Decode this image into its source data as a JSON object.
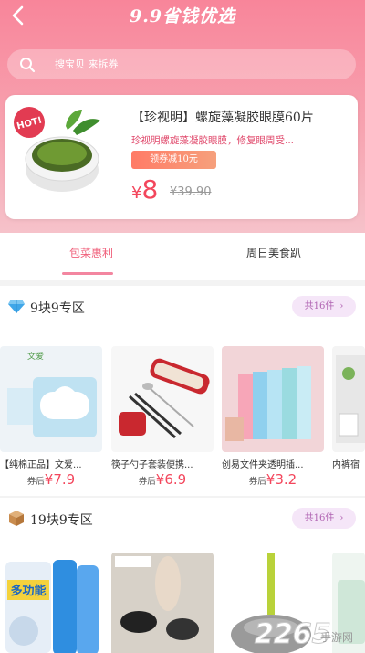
{
  "header": {
    "back_icon": "chevron-left-icon",
    "title": "9.9省钱优选"
  },
  "search": {
    "placeholder": "搜宝贝 来拆券"
  },
  "featured": {
    "badge": "HOT!",
    "title": "【珍视明】螺旋藻凝胶眼膜60片",
    "desc": "珍视明螺旋藻凝胶眼膜，修复眼周受...",
    "coupon": "领券减10元",
    "currency": "¥",
    "price": "8",
    "original_price": "¥39.90"
  },
  "tabs": [
    {
      "label": "包菜惠利",
      "active": true
    },
    {
      "label": "周日美食趴",
      "active": false
    }
  ],
  "sections": [
    {
      "icon": "diamond-icon",
      "title": "9块9专区",
      "count": "共16件",
      "products": [
        {
          "name": "【纯棉正品】文爱...",
          "price_label": "券后",
          "price": "¥7.9"
        },
        {
          "name": "筷子勺子套装便携...",
          "price_label": "券后",
          "price": "¥6.9"
        },
        {
          "name": "创易文件夹透明插...",
          "price_label": "券后",
          "price": "¥3.2"
        },
        {
          "name": "内裤宿",
          "price_label": "",
          "price": ""
        }
      ]
    },
    {
      "icon": "package-icon",
      "title": "19块9专区",
      "count": "共16件",
      "products": [
        {
          "name": "",
          "label": "多功能"
        },
        {
          "name": "",
          "label": ""
        },
        {
          "name": "",
          "label": ""
        },
        {
          "name": "",
          "label": ""
        }
      ]
    }
  ],
  "watermark": {
    "big": "2265",
    "small": "手游网"
  },
  "colors": {
    "accent": "#f3465c",
    "hero": "#f8859a",
    "tab_active": "#f0607b",
    "count_bg": "#f5e6f8"
  }
}
